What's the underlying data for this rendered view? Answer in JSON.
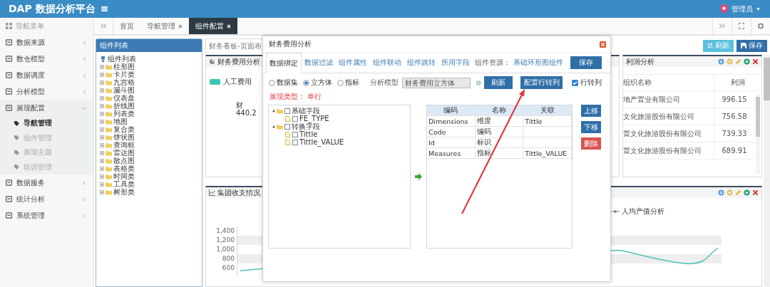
{
  "header": {
    "title": "DAP 数据分析平台",
    "user": "管理员"
  },
  "sidebar": {
    "heading": "导航菜单",
    "items": [
      {
        "label": "数据来源",
        "expanded": false
      },
      {
        "label": "数仓模型",
        "expanded": false
      },
      {
        "label": "数据调度",
        "expanded": false
      },
      {
        "label": "分析模型",
        "expanded": false
      },
      {
        "label": "展现配置",
        "expanded": true,
        "children": [
          {
            "label": "导航管理",
            "selected": true
          },
          {
            "label": "组件管理",
            "selected": false
          },
          {
            "label": "展现主题",
            "selected": false
          },
          {
            "label": "轮训管理",
            "selected": false
          }
        ]
      },
      {
        "label": "数据服务",
        "expanded": false
      },
      {
        "label": "统计分析",
        "expanded": false
      },
      {
        "label": "系统管理",
        "expanded": false
      }
    ]
  },
  "tabs": [
    {
      "label": "首页",
      "closable": false,
      "selected": false
    },
    {
      "label": "导航管理",
      "closable": true,
      "selected": false
    },
    {
      "label": "组件配置",
      "closable": true,
      "selected": true
    }
  ],
  "component_list": {
    "title": "组件列表",
    "root": "组件列表",
    "folders": [
      "柱形图",
      "卡片类",
      "九宫格",
      "漏斗图",
      "仪表盘",
      "折线图",
      "列表类",
      "地图",
      "复合类",
      "饼状图",
      "查询框",
      "雷达图",
      "散点图",
      "表格类",
      "时间类",
      "工具类",
      "树形类"
    ]
  },
  "page_tab": "财务看板-页面布",
  "toolbar_buttons": [
    {
      "label": "刷新",
      "kind": "refresh"
    },
    {
      "label": "保存",
      "kind": "save"
    }
  ],
  "cost_widget": {
    "title": "财务费用分析",
    "legend": "人工费用",
    "labels": [
      "财",
      "440.2"
    ]
  },
  "profit_widget": {
    "title": "利润分析",
    "columns": [
      "组织名称",
      "利润"
    ],
    "rows": [
      {
        "org": "地产置业有限公司",
        "profit": "996.15"
      },
      {
        "org": "文化旅游股份有限公司",
        "profit": "756.58"
      },
      {
        "org": "置文化旅游股份有限公司",
        "profit": "739.33"
      },
      {
        "org": "置文化旅游股份有限公司",
        "profit": "689.91"
      }
    ]
  },
  "income_widget": {
    "title": "集团收支情况",
    "legend": "人均产值分析",
    "y_labels": [
      "1,400",
      "1,200",
      "1,000",
      "800",
      "600"
    ]
  },
  "dialog": {
    "title": "财务费用分析",
    "tabs": [
      {
        "label": "数据绑定",
        "selected": true
      },
      {
        "label": "数据过滤",
        "selected": false
      },
      {
        "label": "组件属性",
        "selected": false
      },
      {
        "label": "组件联动",
        "selected": false
      },
      {
        "label": "组件跳转",
        "selected": false
      },
      {
        "label": "所用字段",
        "selected": false
      }
    ],
    "resource_label": "组件资源：",
    "resource": "基础环形图组件",
    "save": "保存",
    "sources": [
      {
        "label": "数据集",
        "selected": false
      },
      {
        "label": "立方体",
        "selected": true
      },
      {
        "label": "指标",
        "selected": false
      }
    ],
    "model_label": "分析模型",
    "model": "财务费用立方体",
    "refresh": "刷新",
    "pivot_button": "配置行转列",
    "pivot": {
      "label": "行转列",
      "checked": true
    },
    "type_label": "展现类型：",
    "type_value": "单行",
    "fields": [
      {
        "label": "基础字段",
        "expanded": true,
        "checked": false,
        "children": [
          {
            "label": "FE_TYPE",
            "checked": false
          }
        ]
      },
      {
        "label": "转换字段",
        "expanded": true,
        "checked": false,
        "children": [
          {
            "label": "Tittle",
            "checked": false
          },
          {
            "label": "Tittle_VALUE",
            "checked": false
          }
        ]
      }
    ],
    "columns": [
      "编码",
      "名称",
      "关联"
    ],
    "rows": [
      {
        "code": "Dimensions",
        "name": "维度",
        "link": "Tittle"
      },
      {
        "code": "Code",
        "name": "编码"
      },
      {
        "code": "Id",
        "name": "标识"
      },
      {
        "code": "Measures",
        "name": "指标",
        "link": "Tittle_VALUE"
      }
    ],
    "side_buttons": [
      {
        "label": "上移",
        "kind": "primary"
      },
      {
        "label": "下移",
        "kind": "primary"
      },
      {
        "label": "删除",
        "kind": "danger"
      }
    ]
  }
}
